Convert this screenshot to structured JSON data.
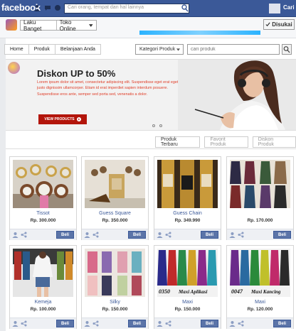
{
  "fb": {
    "logo": "facebook",
    "search_placeholder": "Cari orang, tempat dan hal lainnya",
    "user_label": "Cari"
  },
  "page_header": {
    "shop_name": "Laku Banget",
    "shop_type": "Toko Online",
    "liked_label": "Disukai"
  },
  "shop_nav": {
    "items": [
      "Home",
      "Produk",
      "Belanjaan Anda"
    ],
    "category_label": "Kategori Produk",
    "search_placeholder": "cari produk"
  },
  "hero": {
    "title": "Diskon UP to 50%",
    "body": "Lorem ipsum dolor sit amet, consectetur adipiscing elit. Suspendisse eget erat eget justo dignissim ullamcorper. Etiam id erat imperdiet sapien interdum posuere. Suspendisse eros ante, semper sed porta sed, venenatis a dolor.",
    "cta": "VIEW PRODUCTS"
  },
  "tabs": [
    "Produk Terbaru",
    "Favorit Produk",
    "Diskon Produk"
  ],
  "products": [
    {
      "name": "Tissot",
      "price": "Rp. 300.000",
      "buy": "Beli"
    },
    {
      "name": "Guess Square",
      "price": "Rp. 350.000",
      "buy": "Beli"
    },
    {
      "name": "Guess Chain",
      "price": "Rp. 349.990",
      "buy": "Beli"
    },
    {
      "name": "",
      "price": "Rp. 170.000",
      "buy": "Beli"
    },
    {
      "name": "Kemeja",
      "price": "Rp. 100.000",
      "buy": "Beli"
    },
    {
      "name": "Silky",
      "price": "Rp. 150.000",
      "buy": "Beli"
    },
    {
      "name": "Maxi",
      "price": "Rp. 150.000",
      "buy": "Beli"
    },
    {
      "name": "Maxi",
      "price": "Rp. 120.000",
      "buy": "Beli"
    }
  ],
  "image_captions": {
    "maxi_1_left": "0350",
    "maxi_1_right": "Maxi Aplikasi",
    "maxi_2_left": "0047",
    "maxi_2_right": "Maxi Kancing"
  }
}
